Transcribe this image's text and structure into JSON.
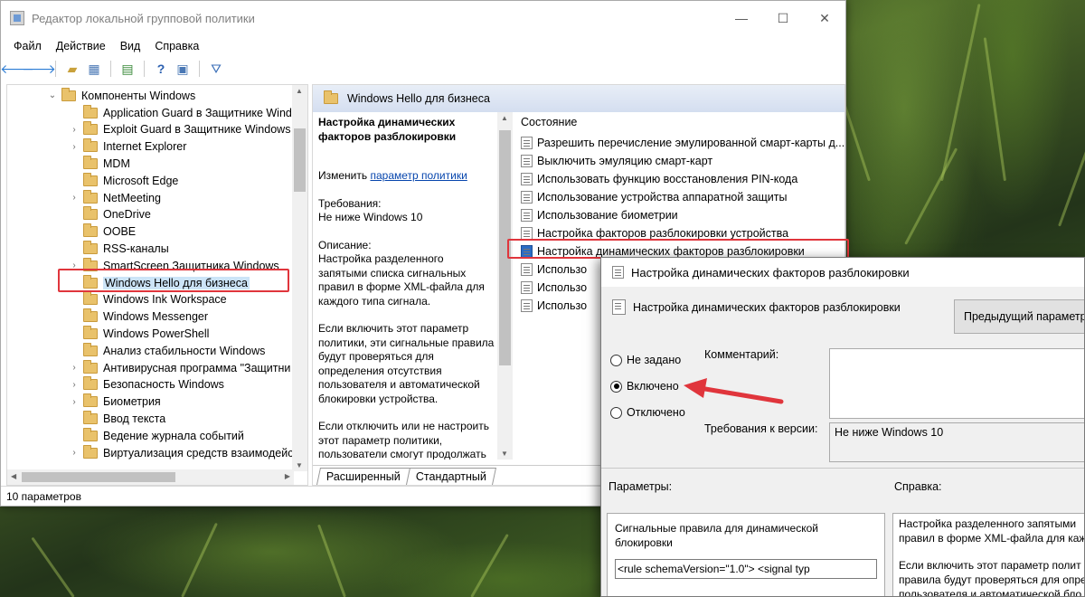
{
  "window": {
    "title": "Редактор локальной групповой политики",
    "minimize": "—",
    "maximize": "☐",
    "close": "✕"
  },
  "menu": [
    "Файл",
    "Действие",
    "Вид",
    "Справка"
  ],
  "tree": {
    "root": "Компоненты Windows",
    "items": [
      {
        "label": "Application Guard в Защитнике Wind",
        "expandable": false
      },
      {
        "label": "Exploit Guard в Защитнике Windows",
        "expandable": true
      },
      {
        "label": "Internet Explorer",
        "expandable": true
      },
      {
        "label": "MDM",
        "expandable": false
      },
      {
        "label": "Microsoft Edge",
        "expandable": false
      },
      {
        "label": "NetMeeting",
        "expandable": true
      },
      {
        "label": "OneDrive",
        "expandable": false
      },
      {
        "label": "OOBE",
        "expandable": false
      },
      {
        "label": "RSS-каналы",
        "expandable": false
      },
      {
        "label": "SmartScreen Защитника Windows",
        "expandable": true
      },
      {
        "label": "Windows Hello для бизнеса",
        "expandable": false,
        "selected": true
      },
      {
        "label": "Windows Ink Workspace",
        "expandable": false
      },
      {
        "label": "Windows Messenger",
        "expandable": false
      },
      {
        "label": "Windows PowerShell",
        "expandable": false
      },
      {
        "label": "Анализ стабильности Windows",
        "expandable": false
      },
      {
        "label": "Антивирусная программа \"Защитни",
        "expandable": true
      },
      {
        "label": "Безопасность Windows",
        "expandable": true
      },
      {
        "label": "Биометрия",
        "expandable": true
      },
      {
        "label": "Ввод текста",
        "expandable": false
      },
      {
        "label": "Ведение журнала событий",
        "expandable": false
      },
      {
        "label": "Виртуализация средств взаимодейст",
        "expandable": true
      }
    ]
  },
  "right": {
    "header": "Windows Hello для бизнеса",
    "desc": {
      "heading": "Настройка динамических факторов разблокировки",
      "edit_prefix": "Изменить ",
      "edit_link": "параметр политики",
      "req_label": "Требования:",
      "req_value": "Не ниже Windows 10",
      "desc_label": "Описание:",
      "desc_text": "Настройка разделенного запятыми списка сигнальных правил в форме XML-файла для каждого типа сигнала.",
      "p2": "Если включить этот параметр политики, эти сигнальные правила будут проверяться для определения отсутствия пользователя и автоматической блокировки устройства.",
      "p3": "Если отключить или не настроить этот параметр политики, пользователи смогут продолжать работать"
    },
    "list_header": "Состояние",
    "settings": [
      "Разрешить перечисление эмулированной смарт-карты д...",
      "Выключить эмуляцию смарт-карт",
      "Использовать функцию восстановления PIN-кода",
      "Использование устройства аппаратной защиты",
      "Использование биометрии",
      "Настройка факторов разблокировки устройства",
      "Настройка динамических факторов разблокировки",
      "Использо",
      "Использо",
      "Использо"
    ],
    "tabs": [
      "Расширенный",
      "Стандартный"
    ]
  },
  "status": "10 параметров",
  "dialog": {
    "title": "Настройка динамических факторов разблокировки",
    "subtitle": "Настройка динамических факторов разблокировки",
    "prev_button": "Предыдущий параметр",
    "radios": [
      {
        "label": "Не задано",
        "checked": false
      },
      {
        "label": "Включено",
        "checked": true
      },
      {
        "label": "Отключено",
        "checked": false
      }
    ],
    "comment_label": "Комментарий:",
    "version_label": "Требования к версии:",
    "version_value": "Не ниже Windows 10",
    "params_label": "Параметры:",
    "help_label": "Справка:",
    "params_text": "Сигнальные правила для динамической блокировки",
    "params_value": "<rule schemaVersion=\"1.0\"> <signal typ",
    "help_p1a": "Настройка разделенного запятыми",
    "help_p1b": "правил в форме XML-файла для каж",
    "help_p2a": "Если включить этот параметр полит",
    "help_p2b": "правила будут проверяться для опре",
    "help_p2c": "пользователя и автоматической бло"
  },
  "colors": {
    "annotation_red": "#e0353c",
    "selection_blue": "#cce4f7",
    "folder_yellow": "#e9c26b"
  }
}
